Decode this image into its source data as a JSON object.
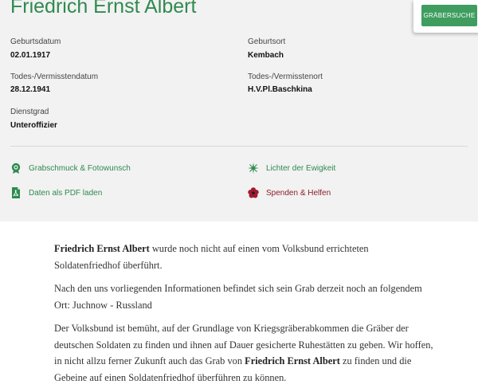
{
  "person": {
    "name": "Friedrich Ernst Albert"
  },
  "header": {
    "search_button": "GRÄBERSUCHE"
  },
  "fields": {
    "birth_date": {
      "label": "Geburtsdatum",
      "value": "02.01.1917"
    },
    "birth_place": {
      "label": "Geburtsort",
      "value": "Kembach"
    },
    "death_date": {
      "label": "Todes-/Vermisstendatum",
      "value": "28.12.1941"
    },
    "death_place": {
      "label": "Todes-/Vermisstenort",
      "value": "H.V.Pl.Baschkina"
    },
    "rank": {
      "label": "Dienstgrad",
      "value": "Unteroffizier"
    }
  },
  "actions": {
    "grave_decoration": {
      "label": "Grabschmuck & Fotowunsch",
      "icon": "rosette-icon"
    },
    "eternity_lights": {
      "label": "Lichter der Ewigkeit",
      "icon": "star-light-icon"
    },
    "pdf": {
      "label": "Daten als PDF laden",
      "icon": "pdf-file-icon"
    },
    "donate": {
      "label": "Spenden & Helfen",
      "icon": "flower-icon"
    }
  },
  "content": {
    "p1_name": "Friedrich Ernst Albert",
    "p1_text": " wurde noch nicht auf einen vom Volksbund errichteten Soldatenfriedhof überführt.",
    "p2_text": "Nach den uns vorliegenden Informationen befindet sich sein Grab derzeit noch an folgendem Ort: Juchnow - Russland",
    "p3_text_a": "Der Volksbund ist bemüht, auf der Grundlage von Kriegsgräberabkommen die Gräber der deutschen Soldaten zu finden und ihnen auf Dauer gesicherte Ruhestätten zu geben. Wir hoffen, in nicht allzu ferner Zukunft auch das Grab von ",
    "p3_name": "Friedrich Ernst Albert",
    "p3_text_b": " zu finden und die Gebeine auf einen Soldatenfriedhof überführen zu können."
  },
  "colors": {
    "brand_green": "#2f8a4f",
    "button_green": "#3e9d5f",
    "donate_red": "#8c1d2c",
    "panel_bg": "#f2f2f2"
  }
}
